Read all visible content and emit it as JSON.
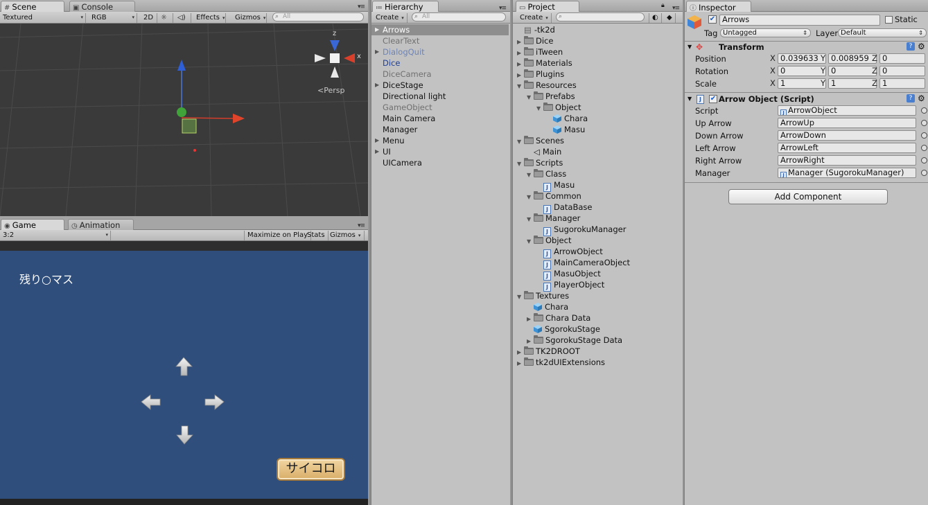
{
  "scene": {
    "tabs": [
      {
        "label": "Scene",
        "icon": "grid-icon"
      },
      {
        "label": "Console",
        "icon": "console-icon"
      }
    ],
    "toolbar": {
      "render_mode": "Textured",
      "color_mode": "RGB",
      "mode_2d": "2D",
      "effects": "Effects",
      "gizmos": "Gizmos",
      "search_placeholder": "All"
    },
    "gizmo": {
      "axis_z": "z",
      "axis_x": "x",
      "projection": "Persp"
    }
  },
  "game": {
    "tabs": [
      {
        "label": "Game",
        "icon": "game-icon"
      },
      {
        "label": "Animation",
        "icon": "clock-icon"
      }
    ],
    "toolbar": {
      "aspect": "3:2",
      "maximize": "Maximize on Play",
      "stats": "Stats",
      "gizmos": "Gizmos"
    },
    "remaining_text": "残り○マス",
    "dice_button": "サイコロ",
    "colors": {
      "background": "#2f4e7c",
      "dice_button": "#e2bb7c"
    }
  },
  "hierarchy": {
    "tab": "Hierarchy",
    "create": "Create",
    "search_placeholder": "All",
    "items": [
      {
        "label": "Arrows",
        "expandable": true,
        "selected": true,
        "style": "selected"
      },
      {
        "label": "ClearText",
        "expandable": false,
        "style": "inactive"
      },
      {
        "label": "DialogQuit",
        "expandable": true,
        "style": "prefab-inactive"
      },
      {
        "label": "Dice",
        "expandable": false,
        "style": "prefab"
      },
      {
        "label": "DiceCamera",
        "expandable": false,
        "style": "inactive"
      },
      {
        "label": "DiceStage",
        "expandable": true,
        "style": "normal"
      },
      {
        "label": "Directional light",
        "expandable": false,
        "style": "normal"
      },
      {
        "label": "GameObject",
        "expandable": false,
        "style": "inactive"
      },
      {
        "label": "Main Camera",
        "expandable": false,
        "style": "normal"
      },
      {
        "label": "Manager",
        "expandable": false,
        "style": "normal"
      },
      {
        "label": "Menu",
        "expandable": true,
        "style": "normal"
      },
      {
        "label": "UI",
        "expandable": true,
        "style": "normal"
      },
      {
        "label": "UICamera",
        "expandable": false,
        "style": "normal"
      }
    ]
  },
  "project": {
    "tab": "Project",
    "create": "Create",
    "items": [
      {
        "label": "-tk2d",
        "depth": 0,
        "arrow": "",
        "icon": "tk2d-icon"
      },
      {
        "label": "Dice",
        "depth": 0,
        "arrow": "▶",
        "icon": "folder-icon"
      },
      {
        "label": "iTween",
        "depth": 0,
        "arrow": "▶",
        "icon": "folder-icon"
      },
      {
        "label": "Materials",
        "depth": 0,
        "arrow": "▶",
        "icon": "folder-icon"
      },
      {
        "label": "Plugins",
        "depth": 0,
        "arrow": "▶",
        "icon": "folder-icon"
      },
      {
        "label": "Resources",
        "depth": 0,
        "arrow": "▼",
        "icon": "folder-icon"
      },
      {
        "label": "Prefabs",
        "depth": 1,
        "arrow": "▼",
        "icon": "folder-icon"
      },
      {
        "label": "Object",
        "depth": 2,
        "arrow": "▼",
        "icon": "folder-icon"
      },
      {
        "label": "Chara",
        "depth": 3,
        "arrow": "",
        "icon": "cube-icon"
      },
      {
        "label": "Masu",
        "depth": 3,
        "arrow": "",
        "icon": "cube-icon"
      },
      {
        "label": "Scenes",
        "depth": 0,
        "arrow": "▼",
        "icon": "folder-icon"
      },
      {
        "label": "Main",
        "depth": 1,
        "arrow": "",
        "icon": "unity-scene-icon"
      },
      {
        "label": "Scripts",
        "depth": 0,
        "arrow": "▼",
        "icon": "folder-icon"
      },
      {
        "label": "Class",
        "depth": 1,
        "arrow": "▼",
        "icon": "folder-icon"
      },
      {
        "label": "Masu",
        "depth": 2,
        "arrow": "",
        "icon": "script-icon"
      },
      {
        "label": "Common",
        "depth": 1,
        "arrow": "▼",
        "icon": "folder-icon"
      },
      {
        "label": "DataBase",
        "depth": 2,
        "arrow": "",
        "icon": "script-icon"
      },
      {
        "label": "Manager",
        "depth": 1,
        "arrow": "▼",
        "icon": "folder-icon"
      },
      {
        "label": "SugorokuManager",
        "depth": 2,
        "arrow": "",
        "icon": "script-icon"
      },
      {
        "label": "Object",
        "depth": 1,
        "arrow": "▼",
        "icon": "folder-icon"
      },
      {
        "label": "ArrowObject",
        "depth": 2,
        "arrow": "",
        "icon": "script-icon"
      },
      {
        "label": "MainCameraObject",
        "depth": 2,
        "arrow": "",
        "icon": "script-icon"
      },
      {
        "label": "MasuObject",
        "depth": 2,
        "arrow": "",
        "icon": "script-icon"
      },
      {
        "label": "PlayerObject",
        "depth": 2,
        "arrow": "",
        "icon": "script-icon"
      },
      {
        "label": "Textures",
        "depth": 0,
        "arrow": "▼",
        "icon": "folder-icon"
      },
      {
        "label": "Chara",
        "depth": 1,
        "arrow": "",
        "icon": "cube-icon"
      },
      {
        "label": "Chara Data",
        "depth": 1,
        "arrow": "▶",
        "icon": "folder-icon"
      },
      {
        "label": "SgorokuStage",
        "depth": 1,
        "arrow": "",
        "icon": "cube-icon"
      },
      {
        "label": "SgorokuStage Data",
        "depth": 1,
        "arrow": "▶",
        "icon": "folder-icon"
      },
      {
        "label": "TK2DROOT",
        "depth": 0,
        "arrow": "▶",
        "icon": "folder-icon"
      },
      {
        "label": "tk2dUIExtensions",
        "depth": 0,
        "arrow": "▶",
        "icon": "folder-icon"
      }
    ]
  },
  "inspector": {
    "tab": "Inspector",
    "object_name": "Arrows",
    "static_label": "Static",
    "tag_label": "Tag",
    "tag_value": "Untagged",
    "layer_label": "Layer",
    "layer_value": "Default",
    "transform": {
      "title": "Transform",
      "rows": [
        {
          "label": "Position",
          "x": "0.039633",
          "y": "0.008959",
          "z": "0"
        },
        {
          "label": "Rotation",
          "x": "0",
          "y": "0",
          "z": "0"
        },
        {
          "label": "Scale",
          "x": "1",
          "y": "1",
          "z": "1"
        }
      ],
      "axis_x": "X",
      "axis_y": "Y",
      "axis_z": "Z"
    },
    "script_component": {
      "title": "Arrow Object (Script)",
      "fields": [
        {
          "label": "Script",
          "value": "ArrowObject",
          "icon": "script-icon"
        },
        {
          "label": "Up Arrow",
          "value": "ArrowUp",
          "icon": ""
        },
        {
          "label": "Down Arrow",
          "value": "ArrowDown",
          "icon": ""
        },
        {
          "label": "Left Arrow",
          "value": "ArrowLeft",
          "icon": ""
        },
        {
          "label": "Right Arrow",
          "value": "ArrowRight",
          "icon": ""
        },
        {
          "label": "Manager",
          "value": "Manager (SugorokuManager)",
          "icon": "script-icon"
        }
      ]
    },
    "add_component": "Add Component"
  }
}
